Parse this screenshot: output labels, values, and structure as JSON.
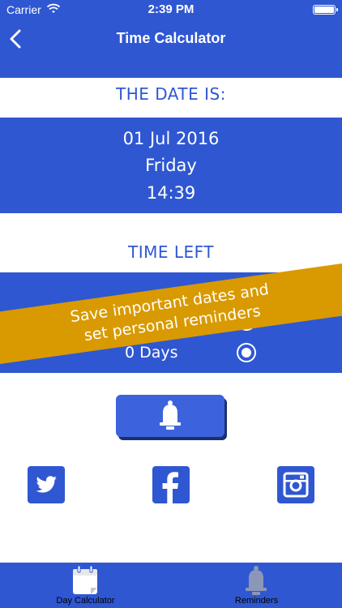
{
  "status_bar": {
    "carrier": "Carrier",
    "time": "2:39 PM"
  },
  "nav": {
    "title": "Time Calculator",
    "back_icon": "chevron-left-icon"
  },
  "date_section": {
    "heading": "THE DATE IS:",
    "date": "01 Jul 2016",
    "weekday": "Friday",
    "time": "14:39"
  },
  "time_left_section": {
    "heading": "TIME LEFT",
    "days_value": "0 Days"
  },
  "banner": {
    "line1": "Save important dates and",
    "line2": "set personal reminders"
  },
  "actions": {
    "reminder_icon": "bell-icon"
  },
  "social": [
    "twitter-icon",
    "facebook-icon",
    "instagram-icon"
  ],
  "tabs": [
    {
      "label": "Day Calculator",
      "icon": "calendar-icon"
    },
    {
      "label": "Reminders",
      "icon": "bell-icon"
    }
  ],
  "colors": {
    "primary": "#2f57d2",
    "banner": "#d89a00",
    "text_light": "#ffffff"
  }
}
